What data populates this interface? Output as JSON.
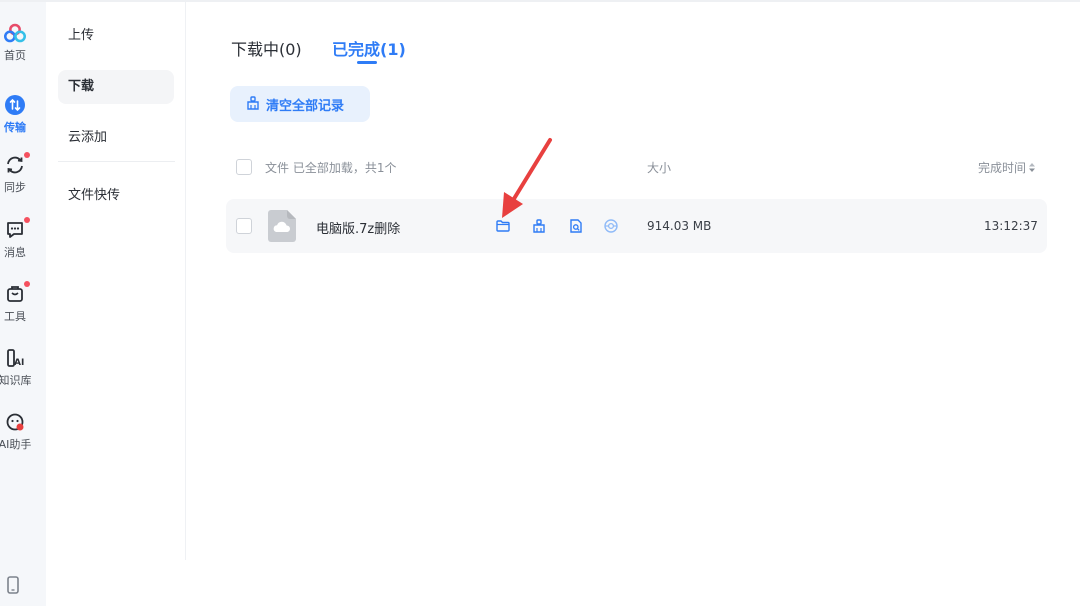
{
  "rail": {
    "items": [
      {
        "key": "home",
        "label": "首页",
        "icon": "baidu-cloud-logo-icon",
        "badge": false,
        "active": false
      },
      {
        "key": "transfer",
        "label": "传输",
        "icon": "transfer-icon",
        "badge": false,
        "active": true
      },
      {
        "key": "sync",
        "label": "同步",
        "icon": "sync-icon",
        "badge": true,
        "active": false
      },
      {
        "key": "messages",
        "label": "消息",
        "icon": "message-icon",
        "badge": true,
        "active": false
      },
      {
        "key": "tools",
        "label": "工具",
        "icon": "toolbox-icon",
        "badge": true,
        "active": false
      },
      {
        "key": "knowledge",
        "label": "知识库",
        "icon": "ai-knowledge-icon",
        "badge": false,
        "active": false
      },
      {
        "key": "assistant",
        "label": "AI助手",
        "icon": "ai-assistant-icon",
        "badge": false,
        "active": false
      }
    ],
    "bottom_icon": "phone-icon"
  },
  "subnav": {
    "items": [
      {
        "label": "上传",
        "active": false
      },
      {
        "label": "下载",
        "active": true
      },
      {
        "label": "云添加",
        "active": false
      },
      {
        "label": "文件快传",
        "active": false
      }
    ]
  },
  "tabs": [
    {
      "label": "下载中(0)",
      "active": false
    },
    {
      "label": "已完成(1)",
      "active": true
    }
  ],
  "clear_button": {
    "label": "清空全部记录",
    "icon": "broom-icon"
  },
  "table": {
    "header": {
      "file_label": "文件 已全部加载，共1个",
      "size_label": "大小",
      "time_label": "完成时间"
    },
    "rows": [
      {
        "name": "电脑版.7z删除",
        "size": "914.03 MB",
        "time": "13:12:37",
        "file_icon": "cloud-file-icon",
        "actions": [
          "open-folder-icon",
          "clear-record-icon",
          "search-file-icon",
          "locate-icon"
        ]
      }
    ]
  },
  "colors": {
    "accent": "#2f7cf6",
    "badge": "#f5515f",
    "annotation_arrow": "#e8403f"
  }
}
